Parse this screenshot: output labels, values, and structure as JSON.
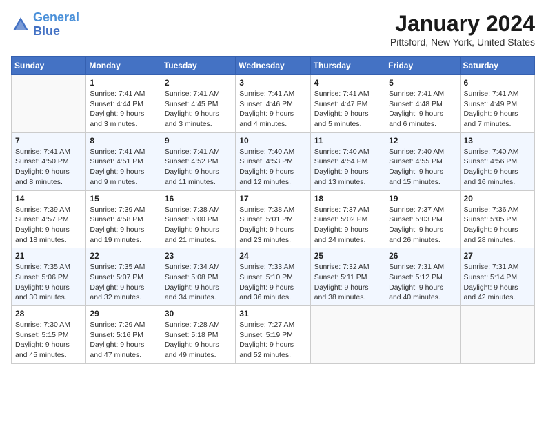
{
  "header": {
    "logo_line1": "General",
    "logo_line2": "Blue",
    "month_title": "January 2024",
    "location": "Pittsford, New York, United States"
  },
  "weekdays": [
    "Sunday",
    "Monday",
    "Tuesday",
    "Wednesday",
    "Thursday",
    "Friday",
    "Saturday"
  ],
  "weeks": [
    [
      {
        "day": "",
        "info": ""
      },
      {
        "day": "1",
        "info": "Sunrise: 7:41 AM\nSunset: 4:44 PM\nDaylight: 9 hours\nand 3 minutes."
      },
      {
        "day": "2",
        "info": "Sunrise: 7:41 AM\nSunset: 4:45 PM\nDaylight: 9 hours\nand 3 minutes."
      },
      {
        "day": "3",
        "info": "Sunrise: 7:41 AM\nSunset: 4:46 PM\nDaylight: 9 hours\nand 4 minutes."
      },
      {
        "day": "4",
        "info": "Sunrise: 7:41 AM\nSunset: 4:47 PM\nDaylight: 9 hours\nand 5 minutes."
      },
      {
        "day": "5",
        "info": "Sunrise: 7:41 AM\nSunset: 4:48 PM\nDaylight: 9 hours\nand 6 minutes."
      },
      {
        "day": "6",
        "info": "Sunrise: 7:41 AM\nSunset: 4:49 PM\nDaylight: 9 hours\nand 7 minutes."
      }
    ],
    [
      {
        "day": "7",
        "info": "Sunrise: 7:41 AM\nSunset: 4:50 PM\nDaylight: 9 hours\nand 8 minutes."
      },
      {
        "day": "8",
        "info": "Sunrise: 7:41 AM\nSunset: 4:51 PM\nDaylight: 9 hours\nand 9 minutes."
      },
      {
        "day": "9",
        "info": "Sunrise: 7:41 AM\nSunset: 4:52 PM\nDaylight: 9 hours\nand 11 minutes."
      },
      {
        "day": "10",
        "info": "Sunrise: 7:40 AM\nSunset: 4:53 PM\nDaylight: 9 hours\nand 12 minutes."
      },
      {
        "day": "11",
        "info": "Sunrise: 7:40 AM\nSunset: 4:54 PM\nDaylight: 9 hours\nand 13 minutes."
      },
      {
        "day": "12",
        "info": "Sunrise: 7:40 AM\nSunset: 4:55 PM\nDaylight: 9 hours\nand 15 minutes."
      },
      {
        "day": "13",
        "info": "Sunrise: 7:40 AM\nSunset: 4:56 PM\nDaylight: 9 hours\nand 16 minutes."
      }
    ],
    [
      {
        "day": "14",
        "info": "Sunrise: 7:39 AM\nSunset: 4:57 PM\nDaylight: 9 hours\nand 18 minutes."
      },
      {
        "day": "15",
        "info": "Sunrise: 7:39 AM\nSunset: 4:58 PM\nDaylight: 9 hours\nand 19 minutes."
      },
      {
        "day": "16",
        "info": "Sunrise: 7:38 AM\nSunset: 5:00 PM\nDaylight: 9 hours\nand 21 minutes."
      },
      {
        "day": "17",
        "info": "Sunrise: 7:38 AM\nSunset: 5:01 PM\nDaylight: 9 hours\nand 23 minutes."
      },
      {
        "day": "18",
        "info": "Sunrise: 7:37 AM\nSunset: 5:02 PM\nDaylight: 9 hours\nand 24 minutes."
      },
      {
        "day": "19",
        "info": "Sunrise: 7:37 AM\nSunset: 5:03 PM\nDaylight: 9 hours\nand 26 minutes."
      },
      {
        "day": "20",
        "info": "Sunrise: 7:36 AM\nSunset: 5:05 PM\nDaylight: 9 hours\nand 28 minutes."
      }
    ],
    [
      {
        "day": "21",
        "info": "Sunrise: 7:35 AM\nSunset: 5:06 PM\nDaylight: 9 hours\nand 30 minutes."
      },
      {
        "day": "22",
        "info": "Sunrise: 7:35 AM\nSunset: 5:07 PM\nDaylight: 9 hours\nand 32 minutes."
      },
      {
        "day": "23",
        "info": "Sunrise: 7:34 AM\nSunset: 5:08 PM\nDaylight: 9 hours\nand 34 minutes."
      },
      {
        "day": "24",
        "info": "Sunrise: 7:33 AM\nSunset: 5:10 PM\nDaylight: 9 hours\nand 36 minutes."
      },
      {
        "day": "25",
        "info": "Sunrise: 7:32 AM\nSunset: 5:11 PM\nDaylight: 9 hours\nand 38 minutes."
      },
      {
        "day": "26",
        "info": "Sunrise: 7:31 AM\nSunset: 5:12 PM\nDaylight: 9 hours\nand 40 minutes."
      },
      {
        "day": "27",
        "info": "Sunrise: 7:31 AM\nSunset: 5:14 PM\nDaylight: 9 hours\nand 42 minutes."
      }
    ],
    [
      {
        "day": "28",
        "info": "Sunrise: 7:30 AM\nSunset: 5:15 PM\nDaylight: 9 hours\nand 45 minutes."
      },
      {
        "day": "29",
        "info": "Sunrise: 7:29 AM\nSunset: 5:16 PM\nDaylight: 9 hours\nand 47 minutes."
      },
      {
        "day": "30",
        "info": "Sunrise: 7:28 AM\nSunset: 5:18 PM\nDaylight: 9 hours\nand 49 minutes."
      },
      {
        "day": "31",
        "info": "Sunrise: 7:27 AM\nSunset: 5:19 PM\nDaylight: 9 hours\nand 52 minutes."
      },
      {
        "day": "",
        "info": ""
      },
      {
        "day": "",
        "info": ""
      },
      {
        "day": "",
        "info": ""
      }
    ]
  ]
}
